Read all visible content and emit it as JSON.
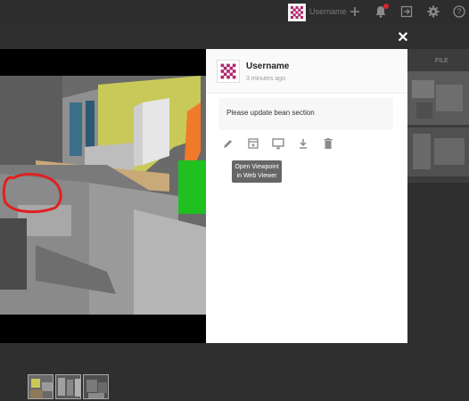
{
  "topbar": {
    "username": "Username",
    "icons": [
      "logo-avatar",
      "plus-icon",
      "bell-icon",
      "export-icon",
      "gear-icon",
      "help-icon"
    ]
  },
  "background": {
    "file_label": "FILE"
  },
  "panel": {
    "username": "Username",
    "timestamp": "3 minutes ago",
    "comment": "Please update bean section",
    "actions": [
      "edit-icon",
      "viewpoint-icon",
      "web-viewer-icon",
      "download-icon",
      "delete-icon"
    ],
    "tooltip_line1": "Open Viewpoint",
    "tooltip_line2": "in Web Viewer"
  },
  "close_label": "✕",
  "thumbnails": [
    "thumb-1",
    "thumb-2",
    "thumb-3"
  ],
  "colors": {
    "annotation_red": "#e0201f",
    "wall_yellow": "#c9c95a",
    "accent_orange": "#f07a2a",
    "accent_green": "#20c020"
  }
}
